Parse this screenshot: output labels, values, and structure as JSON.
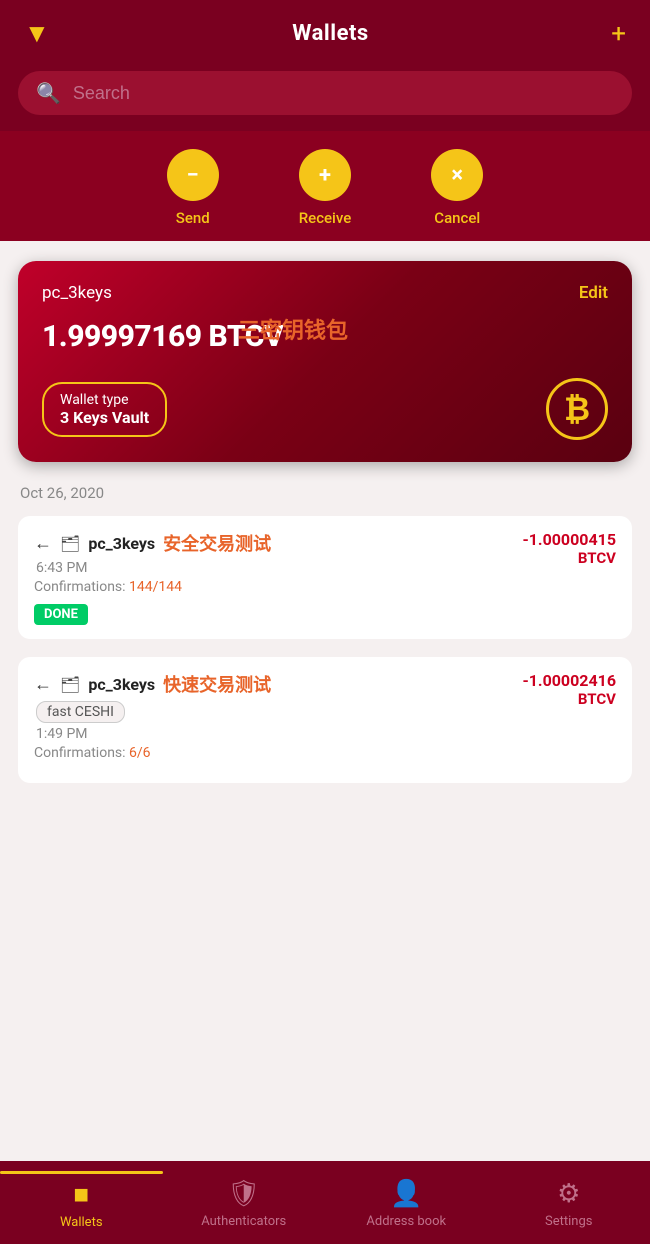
{
  "header": {
    "title": "Wallets",
    "filter_icon": "▼",
    "add_icon": "+"
  },
  "search": {
    "placeholder": "Search"
  },
  "actions": [
    {
      "id": "send",
      "icon": "−",
      "label": "Send"
    },
    {
      "id": "receive",
      "icon": "+",
      "label": "Receive"
    },
    {
      "id": "cancel",
      "icon": "×",
      "label": "Cancel"
    }
  ],
  "wallet_card": {
    "name": "pc_3keys",
    "edit_label": "Edit",
    "balance": "1.99997169 BTCV",
    "wallet_type_label": "Wallet type",
    "wallet_type_value": "3 Keys Vault",
    "btc_symbol": "₿",
    "annotation_zh": "三密钥钱包"
  },
  "date_separator": "Oct 26, 2020",
  "transactions": [
    {
      "id": "tx1",
      "arrow": "←",
      "wallet_icon": "🗂",
      "wallet_name": "pc_3keys",
      "annotation_zh": "安全交易测试",
      "time": "6:43 PM",
      "confirmations_label": "Confirmations: ",
      "confirmations_value": "144/144",
      "badge": "DONE",
      "amount": "-1.00000415",
      "currency": "BTCV"
    },
    {
      "id": "tx2",
      "arrow": "←",
      "wallet_icon": "🗂",
      "wallet_name": "pc_3keys",
      "annotation_zh": "快速交易测试",
      "fast_label": "fast CESHI",
      "time": "1:49 PM",
      "confirmations_label": "Confirmations: ",
      "confirmations_value": "6/6",
      "amount": "-1.00002416",
      "currency": "BTCV"
    }
  ],
  "bottom_nav": [
    {
      "id": "wallets",
      "icon": "▣",
      "label": "Wallets",
      "active": true
    },
    {
      "id": "authenticators",
      "icon": "🛡",
      "label": "Authenticators",
      "active": false
    },
    {
      "id": "address_book",
      "icon": "👤",
      "label": "Address book",
      "active": false
    },
    {
      "id": "settings",
      "icon": "⚙",
      "label": "Settings",
      "active": false
    }
  ]
}
